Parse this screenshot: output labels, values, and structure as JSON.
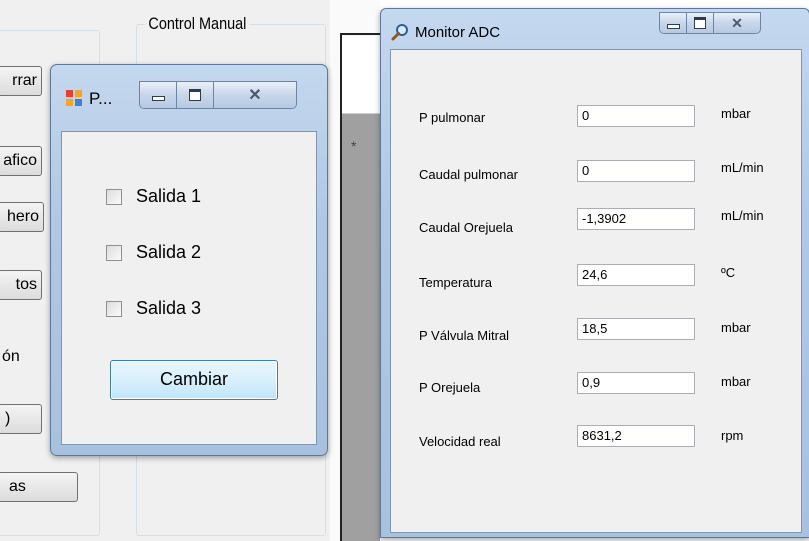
{
  "control_manual": {
    "title": "Control Manual"
  },
  "side_buttons": [
    {
      "label": "rrar"
    },
    {
      "label": "afico"
    },
    {
      "label": "hero"
    },
    {
      "label": "tos"
    },
    {
      "label": "ón"
    },
    {
      "label": ")"
    },
    {
      "label": "as"
    }
  ],
  "strip": {
    "marker": "*"
  },
  "dialog": {
    "title": "P...",
    "checkboxes": [
      {
        "label": "Salida 1",
        "checked": false
      },
      {
        "label": "Salida 2",
        "checked": false
      },
      {
        "label": "Salida 3",
        "checked": false
      }
    ],
    "button_label": "Cambiar"
  },
  "monitor": {
    "title": "Monitor ADC",
    "rows": [
      {
        "label": "P pulmonar",
        "value": "0",
        "unit": "mbar"
      },
      {
        "label": "Caudal pulmonar",
        "value": "0",
        "unit": "mL/min"
      },
      {
        "label": "Caudal Orejuela",
        "value": "-1,3902",
        "unit": "mL/min"
      },
      {
        "label": "Temperatura",
        "value": "24,6",
        "unit": "ºC"
      },
      {
        "label": "P Válvula Mitral",
        "value": "18,5",
        "unit": "mbar"
      },
      {
        "label": "P Orejuela",
        "value": "0,9",
        "unit": "mbar"
      },
      {
        "label": "Velocidad real",
        "value": "8631,2",
        "unit": "rpm"
      }
    ]
  },
  "icons": {
    "dialog": "form-app-icon",
    "monitor": "magnifier-icon",
    "minimize": "minimize-icon",
    "maximize": "maximize-icon",
    "close": "close-icon"
  },
  "colors": {
    "titlebar": "#b0c8e4",
    "client": "#f0f0f0",
    "button_border": "#3c7fb1"
  }
}
